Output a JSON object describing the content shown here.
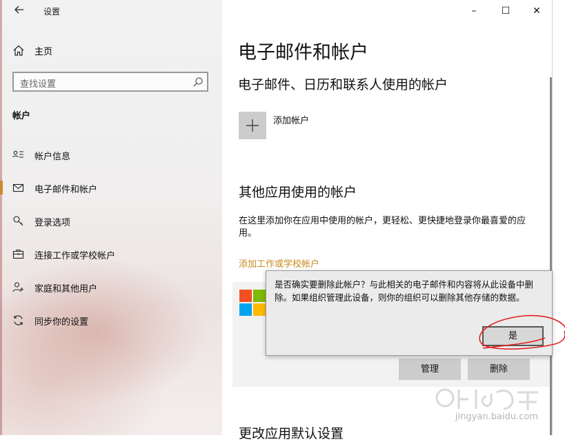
{
  "window": {
    "title": "设置",
    "controls": {
      "minimize": "–",
      "maximize": "☐",
      "close": "✕"
    }
  },
  "sidebar": {
    "home_label": "主页",
    "search_placeholder": "查找设置",
    "section_title": "帐户",
    "items": [
      {
        "label": "帐户信息",
        "icon": "person-list-icon",
        "selected": false
      },
      {
        "label": "电子邮件和帐户",
        "icon": "mail-icon",
        "selected": true
      },
      {
        "label": "登录选项",
        "icon": "key-icon",
        "selected": false
      },
      {
        "label": "连接工作或学校帐户",
        "icon": "briefcase-icon",
        "selected": false
      },
      {
        "label": "家庭和其他用户",
        "icon": "person-add-icon",
        "selected": false
      },
      {
        "label": "同步你的设置",
        "icon": "sync-icon",
        "selected": false
      }
    ]
  },
  "main": {
    "page_title": "电子邮件和帐户",
    "section1_title": "电子邮件、日历和联系人使用的帐户",
    "add_account_label": "添加帐户",
    "section2_title": "其他应用使用的帐户",
    "section2_desc": "在这里添加你在应用中使用的帐户，更轻松、更快捷地登录你最喜爱的应用。",
    "add_work_link": "添加工作或学校帐户",
    "manage_button": "管理",
    "remove_button": "删除",
    "section3_title": "更改应用默认设置"
  },
  "dialog": {
    "message": "是否确实要删除此帐户？与此相关的电子邮件和内容将从此设备中删除。如果组织管理此设备，则你的组织可以删除其他存储的数据。",
    "yes_button": "是"
  },
  "watermark": {
    "text": "jingyan.baidu.com"
  },
  "colors": {
    "accent": "#c98a2e",
    "link": "#c88a1f",
    "annotation": "#e02020"
  }
}
